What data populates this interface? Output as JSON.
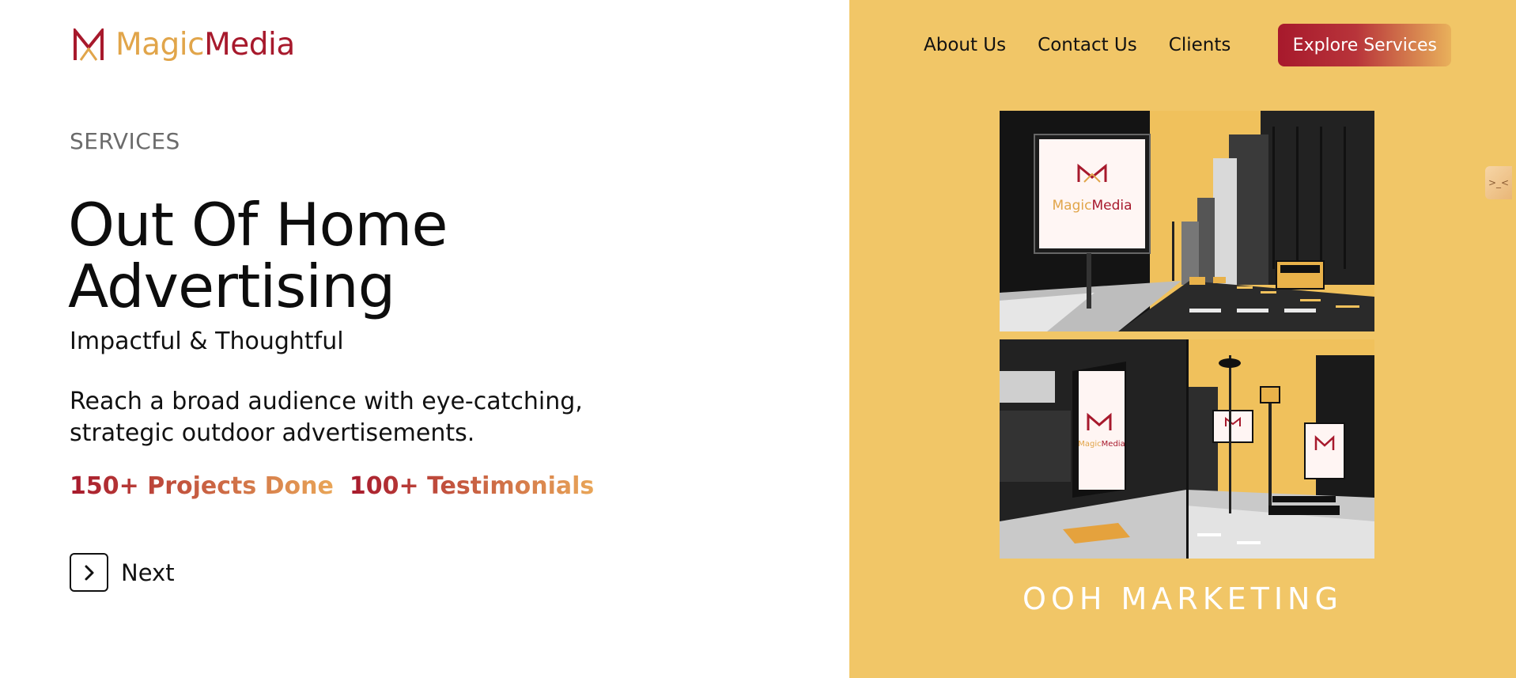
{
  "brand": {
    "magic": "Magic",
    "media": "Media"
  },
  "nav": {
    "about": "About Us",
    "contact": "Contact Us",
    "clients": "Clients",
    "cta": "Explore Services"
  },
  "hero": {
    "eyebrow": "SERVICES",
    "title": "Out Of Home Advertising",
    "subtitle": "Impactful & Thoughtful",
    "description": "Reach a broad audience with eye-catching, strategic outdoor advertisements.",
    "stats": [
      "150+ Projects Done",
      "100+ Testimonials"
    ],
    "next_label": "Next"
  },
  "gallery": {
    "caption": "OOH MARKETING",
    "billboard_magic": "Magic",
    "billboard_media": "Media"
  },
  "colors": {
    "accent_red": "#a7192c",
    "accent_gold": "#e1a54a",
    "panel_yellow": "#f1c667"
  },
  "icons": [
    "logo-mark-icon",
    "chevron-right-icon",
    "widget-icon"
  ]
}
